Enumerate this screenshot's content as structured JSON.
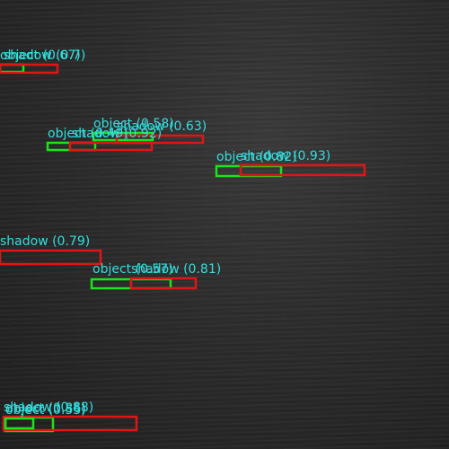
{
  "colors": {
    "object": "#19e619",
    "shadow": "#e01616",
    "label": "#33dede"
  },
  "detections": [
    {
      "cls": "object",
      "score": "0.67",
      "text": "object (0.67)"
    },
    {
      "cls": "shadow",
      "score": "0.7",
      "text": "shadow (0.7)"
    },
    {
      "cls": "object",
      "score": "0.58",
      "text": "object (0.58)"
    },
    {
      "cls": "shadow",
      "score": "0.63",
      "text": "shadow (0.63)"
    },
    {
      "cls": "object",
      "score": "0.49",
      "text": "object (0.49)"
    },
    {
      "cls": "shadow",
      "score": "0.92",
      "text": "shadow (0.92)"
    },
    {
      "cls": "object",
      "score": "0.82",
      "text": "object (0.82)"
    },
    {
      "cls": "shadow",
      "score": "0.93",
      "text": "shadow (0.93)"
    },
    {
      "cls": "shadow",
      "score": "0.79",
      "text": "shadow (0.79)"
    },
    {
      "cls": "object",
      "score": "0.57",
      "text": "object (0.57)"
    },
    {
      "cls": "shadow",
      "score": "0.81",
      "text": "shadow (0.81)"
    },
    {
      "cls": "object",
      "score": "0.86",
      "text": "object (0.86)"
    },
    {
      "cls": "shadow",
      "score": "0.88",
      "text": "shadow (0.88)"
    },
    {
      "cls": "object",
      "score": "0.55",
      "text": "object (0.55)"
    }
  ]
}
